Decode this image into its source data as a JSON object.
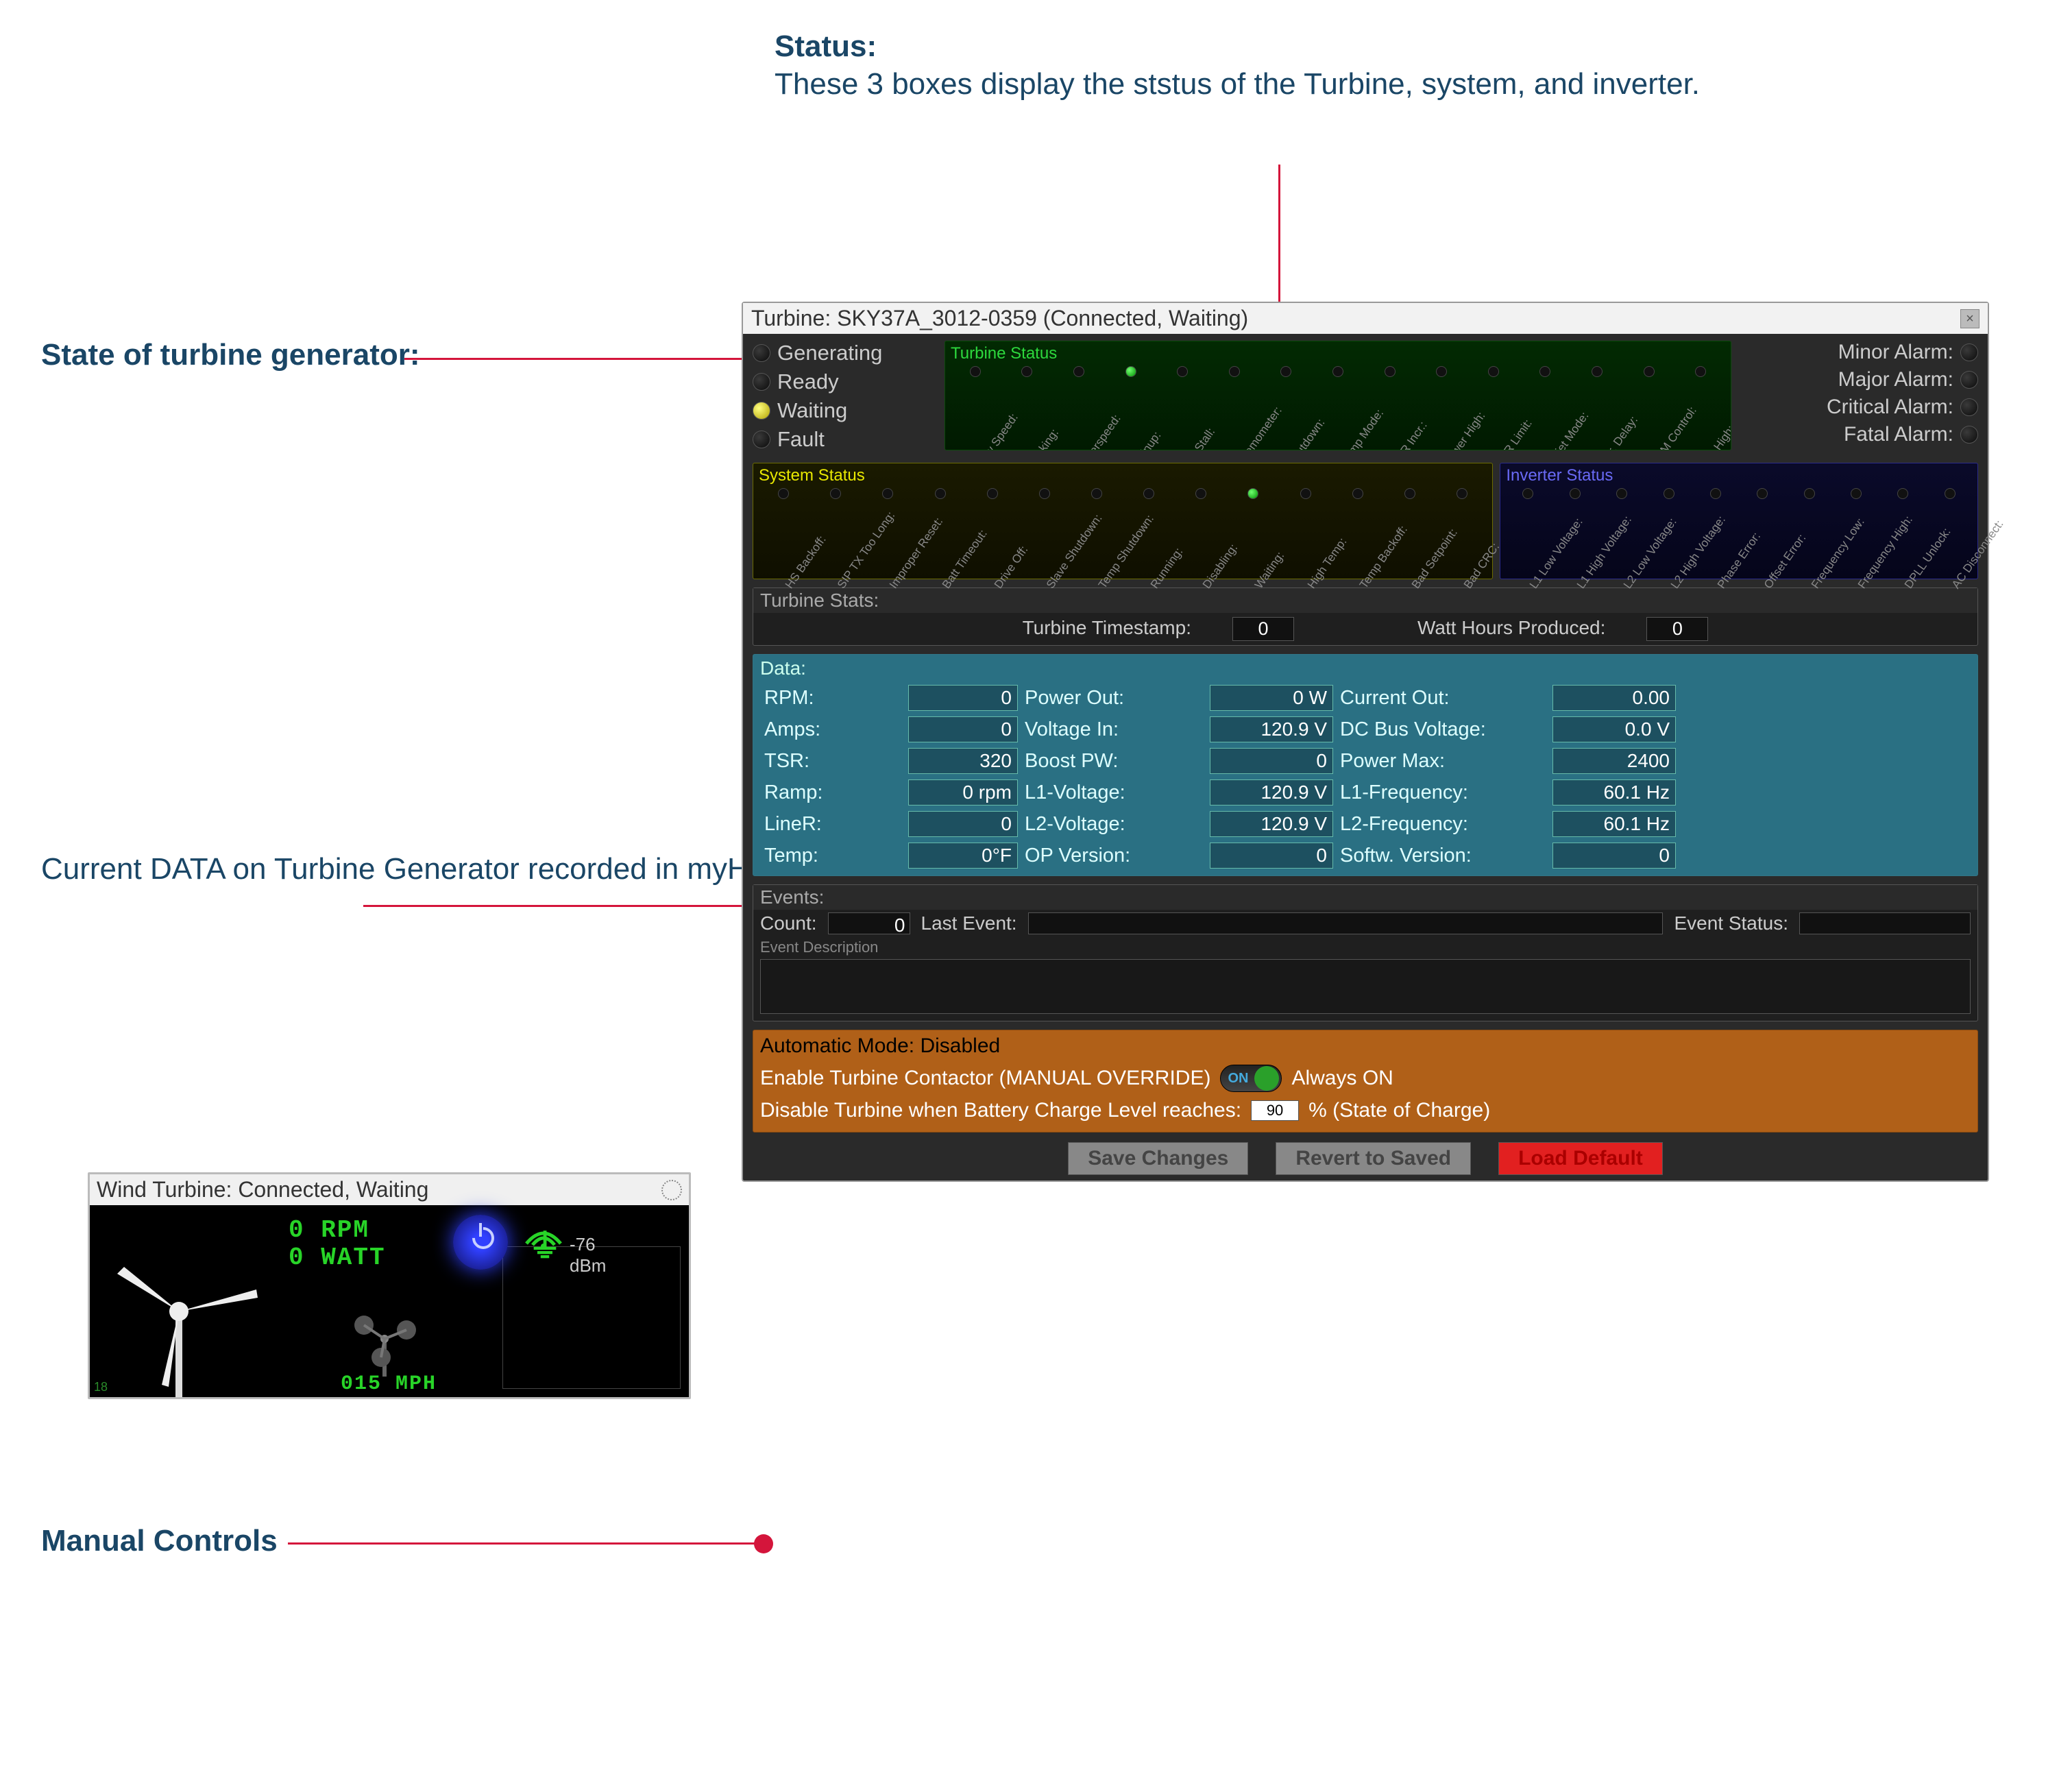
{
  "annotations": {
    "status_title": "Status:",
    "status_body": "These 3 boxes display the ststus of the Turbine, system, and inverter.",
    "state_label": "State of turbine generator:",
    "data_label": "Current DATA on Turbine Generator recorded in myHCI",
    "manual_label": "Manual Controls"
  },
  "dialog": {
    "title": "Turbine: SKY37A_3012-0359 (Connected, Waiting)"
  },
  "states": {
    "generating": "Generating",
    "ready": "Ready",
    "waiting": "Waiting",
    "fault": "Fault",
    "active": "waiting"
  },
  "alarms": {
    "minor": "Minor Alarm:",
    "major": "Major Alarm:",
    "critical": "Critical Alarm:",
    "fatal": "Fatal Alarm:"
  },
  "turbine_status": {
    "title": "Turbine Status",
    "labels": [
      "Low Speed:",
      "Braking:",
      "Overspeed:",
      "Spinup:",
      "No Stall:",
      "Anemometer:",
      "Shutdown:",
      "Ramp Mode:",
      "TSR Incr.:",
      "Power High:",
      "TSR Limit:",
      "Quiet Mode:",
      "Incr. Delay:",
      "RPM Control:",
      "Vin High:"
    ],
    "active_index": 3
  },
  "system_status": {
    "title": "System Status",
    "labels": [
      "HS Backoff:",
      "SIP TX Too Long:",
      "Improper Reset:",
      "Batt Timeout:",
      "Drive Off:",
      "Slave Shutdown:",
      "Temp Shutdown:",
      "Running:",
      "Disabling:",
      "Waiting:",
      "High Temp:",
      "Temp Backoff:",
      "Bad Setpoint:",
      "Bad CRC:"
    ],
    "active_index": 9
  },
  "inverter_status": {
    "title": "Inverter Status",
    "labels": [
      "L1 Low Voltage:",
      "L1 High Voltage:",
      "L2 Low Voltage:",
      "L2 High Voltage:",
      "Phase Error:",
      "Offset Error:",
      "Frequency Low:",
      "Frequency High:",
      "DPLL Unlock:",
      "AC Disconnect:"
    ]
  },
  "turbine_stats": {
    "title": "Turbine Stats:",
    "timestamp_label": "Turbine Timestamp:",
    "timestamp_val": "0",
    "watthours_label": "Watt Hours Produced:",
    "watthours_val": "0"
  },
  "data": {
    "title": "Data:",
    "rows": [
      {
        "l1": "RPM:",
        "v1": "0",
        "l2": "Power Out:",
        "v2": "0 W",
        "l3": "Current Out:",
        "v3": "0.00"
      },
      {
        "l1": "Amps:",
        "v1": "0",
        "l2": "Voltage In:",
        "v2": "120.9 V",
        "l3": "DC Bus Voltage:",
        "v3": "0.0 V"
      },
      {
        "l1": "TSR:",
        "v1": "320",
        "l2": "Boost PW:",
        "v2": "0",
        "l3": "Power Max:",
        "v3": "2400"
      },
      {
        "l1": "Ramp:",
        "v1": "0 rpm",
        "l2": "L1-Voltage:",
        "v2": "120.9 V",
        "l3": "L1-Frequency:",
        "v3": "60.1 Hz"
      },
      {
        "l1": "LineR:",
        "v1": "0",
        "l2": "L2-Voltage:",
        "v2": "120.9 V",
        "l3": "L2-Frequency:",
        "v3": "60.1 Hz"
      },
      {
        "l1": "Temp:",
        "v1": "0°F",
        "l2": "OP Version:",
        "v2": "0",
        "l3": "Softw. Version:",
        "v3": "0"
      }
    ]
  },
  "events": {
    "title": "Events:",
    "count_label": "Count:",
    "count_val": "0",
    "last_event_label": "Last Event:",
    "status_label": "Event Status:",
    "desc_label": "Event Description"
  },
  "auto": {
    "title_label": "Automatic Mode:",
    "title_state": "Disabled",
    "enable_line": "Enable Turbine Contactor (MANUAL OVERRIDE)",
    "toggle_on": "ON",
    "always_on": "Always ON",
    "disable_line_pre": "Disable Turbine when Battery Charge Level reaches:",
    "disable_pct": "90",
    "disable_line_post": "%  (State of Charge)"
  },
  "buttons": {
    "save": "Save Changes",
    "revert": "Revert to Saved",
    "load": "Load Default"
  },
  "mini": {
    "title": "Wind Turbine: Connected, Waiting",
    "rpm": "0 RPM",
    "watt": "0 WATT",
    "mph": "015 MPH",
    "dbm": "-76 dBm",
    "corner": "18"
  }
}
